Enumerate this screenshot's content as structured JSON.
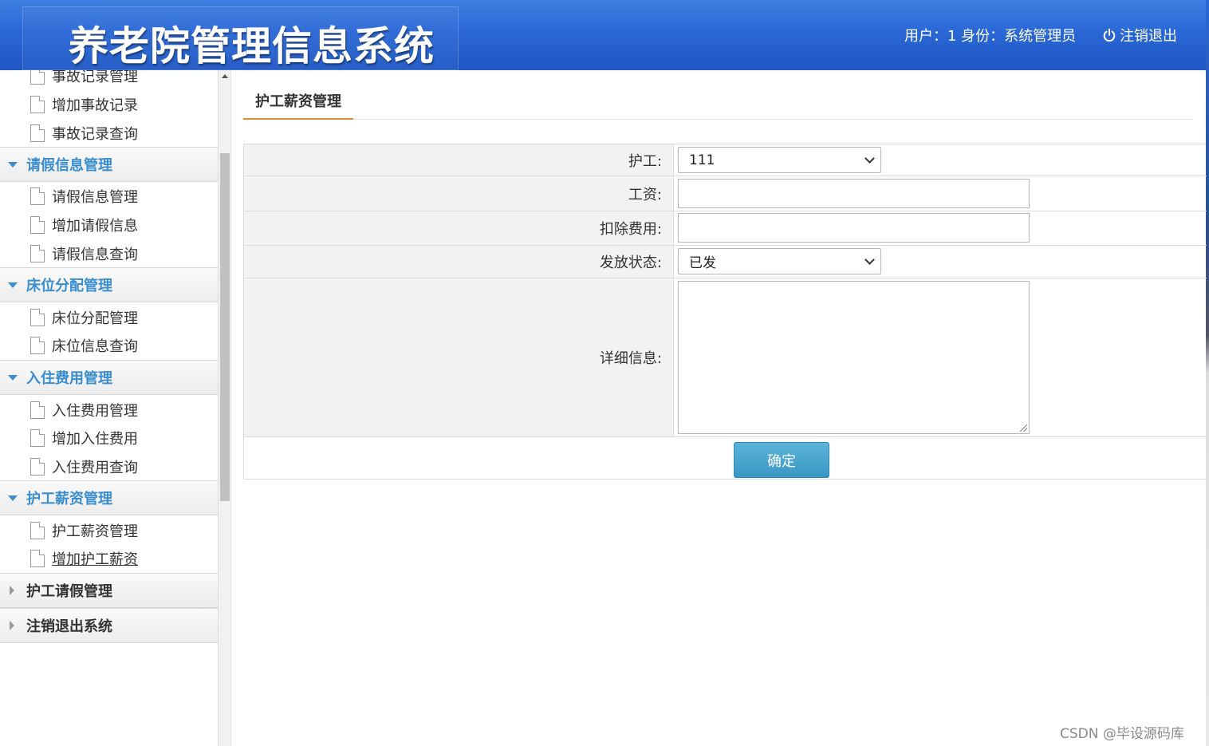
{
  "header": {
    "title": "养老院管理信息系统",
    "user_info": "用户：1 身份：系统管理员",
    "logout": "注销退出"
  },
  "sidebar": {
    "items_top": [
      "事故记录管理",
      "增加事故记录",
      "事故记录查询"
    ],
    "groups": [
      {
        "label": "请假信息管理",
        "expanded": true,
        "items": [
          "请假信息管理",
          "增加请假信息",
          "请假信息查询"
        ]
      },
      {
        "label": "床位分配管理",
        "expanded": true,
        "items": [
          "床位分配管理",
          "床位信息查询"
        ]
      },
      {
        "label": "入住费用管理",
        "expanded": true,
        "items": [
          "入住费用管理",
          "增加入住费用",
          "入住费用查询"
        ]
      },
      {
        "label": "护工薪资管理",
        "expanded": true,
        "items": [
          "护工薪资管理",
          "增加护工薪资"
        ]
      },
      {
        "label": "护工请假管理",
        "expanded": false,
        "items": []
      },
      {
        "label": "注销退出系统",
        "expanded": false,
        "items": []
      }
    ]
  },
  "main": {
    "tab_title": "护工薪资管理",
    "form": {
      "nurse_label": "护工:",
      "nurse_value": "111",
      "salary_label": "工资:",
      "salary_value": "",
      "deduction_label": "扣除费用:",
      "deduction_value": "",
      "status_label": "发放状态:",
      "status_value": "已发",
      "detail_label": "详细信息:",
      "detail_value": "",
      "submit_label": "确定"
    }
  },
  "watermark": "CSDN @毕设源码库",
  "colors": {
    "header_blue": "#2a68d6",
    "accent_blue": "#3a8ed0",
    "tab_underline": "#e08a3a",
    "button": "#3a97c4"
  }
}
